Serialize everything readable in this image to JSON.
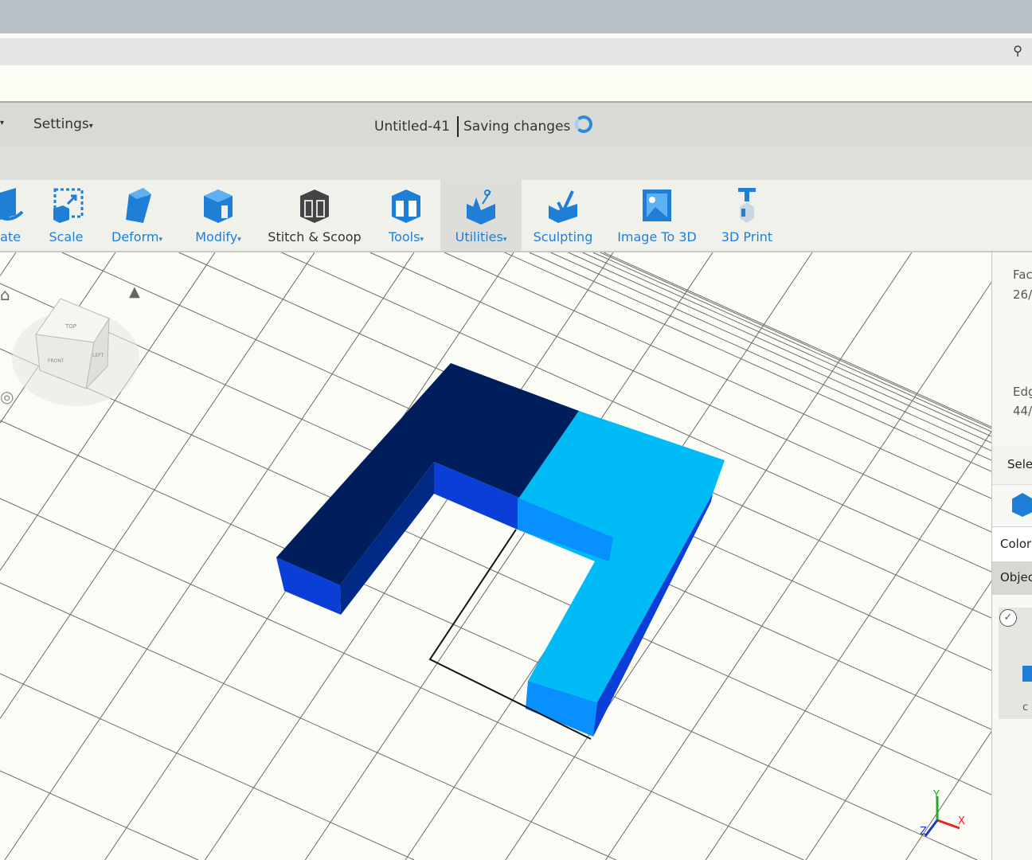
{
  "menu": {
    "settings": "Settings",
    "doc_title": "Untitled-41",
    "status": "Saving changes"
  },
  "tools": [
    {
      "label": "tate"
    },
    {
      "label": "Scale"
    },
    {
      "label": "Deform"
    },
    {
      "label": "Modify"
    },
    {
      "label": "Stitch & Scoop"
    },
    {
      "label": "Tools"
    },
    {
      "label": "Utilities"
    },
    {
      "label": "Sculpting"
    },
    {
      "label": "Image To 3D"
    },
    {
      "label": "3D Print"
    }
  ],
  "viewcube": {
    "top": "TOP",
    "front": "FRONT",
    "left": "LEFT"
  },
  "panel": {
    "faces_label": "Fac",
    "faces_value": "26/",
    "edges_label": "Edg",
    "edges_value": "44/",
    "select_label": "Sele",
    "color_label": "Color",
    "objects_label": "Objec",
    "object_name": "c"
  },
  "axes": {
    "x": "X",
    "y": "Y",
    "z": "Z"
  },
  "colors": {
    "accent": "#1f7fd6",
    "shape_dark": "#001d5c",
    "shape_light": "#00bbf5"
  }
}
